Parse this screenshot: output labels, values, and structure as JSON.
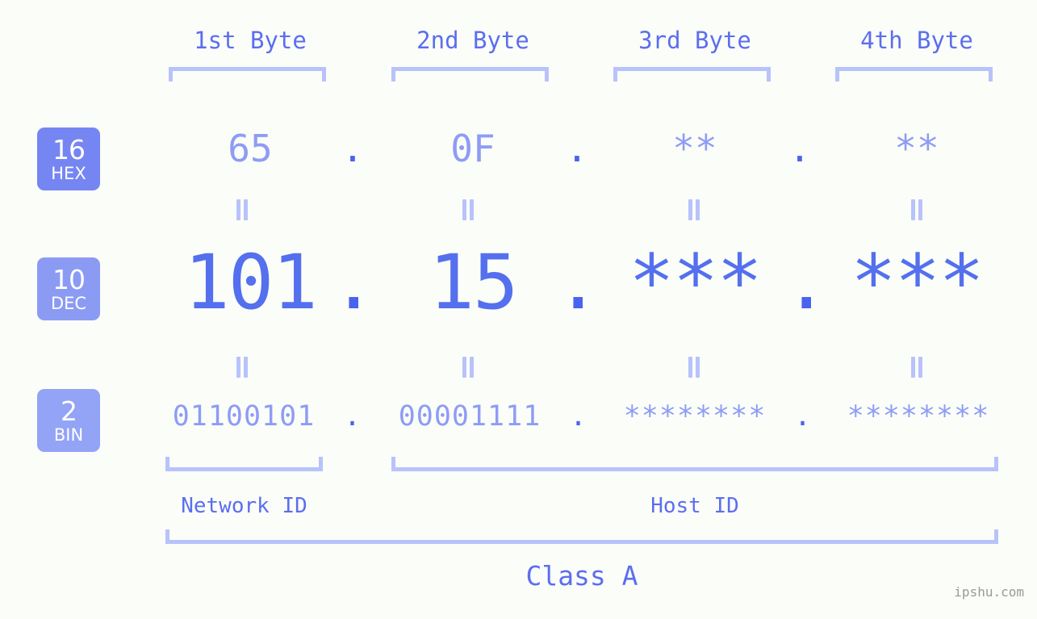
{
  "background_color": "#fbfdf8",
  "accent_color": "#5470ee",
  "light_accent_color": "#8e9cf5",
  "bracket_color": "#b8c2fb",
  "byte_headers": [
    {
      "label": "1st Byte"
    },
    {
      "label": "2nd Byte"
    },
    {
      "label": "3rd Byte"
    },
    {
      "label": "4th Byte"
    }
  ],
  "bases": [
    {
      "num": "16",
      "abbr": "HEX",
      "color": "#7586f2"
    },
    {
      "num": "10",
      "abbr": "DEC",
      "color": "#8b9bf4"
    },
    {
      "num": "2",
      "abbr": "BIN",
      "color": "#93a3f6"
    }
  ],
  "rows": {
    "hex": {
      "values": [
        "65",
        "0F",
        "**",
        "**"
      ],
      "separator": "."
    },
    "dec": {
      "values": [
        "101",
        "15",
        "***",
        "***"
      ],
      "separator": "."
    },
    "bin": {
      "values": [
        "01100101",
        "00001111",
        "********",
        "********"
      ],
      "separator": "."
    }
  },
  "connector_symbol": "=",
  "segments": {
    "network_id": "Network ID",
    "host_id": "Host ID"
  },
  "class_label": "Class A",
  "watermark": "ipshu.com"
}
